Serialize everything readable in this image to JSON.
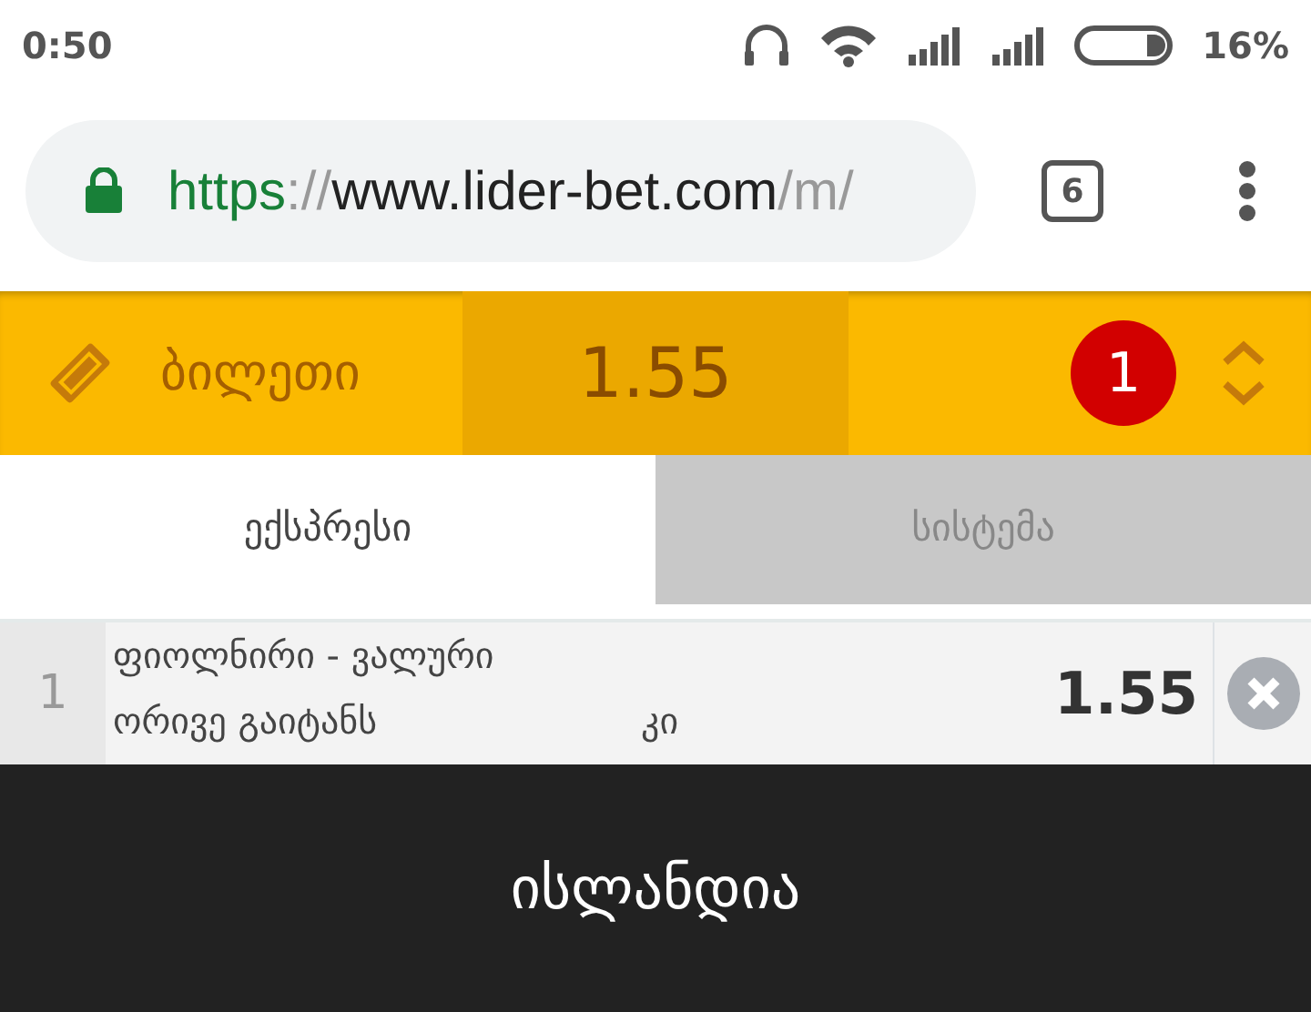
{
  "status_bar": {
    "time": "0:50",
    "battery": "16%"
  },
  "browser": {
    "url_scheme": "https",
    "url_separator": "://",
    "url_host": "www.lider-bet.com",
    "url_path": "/m/",
    "tab_count": "6"
  },
  "bet_slip": {
    "label": "ბილეთი",
    "total_odds": "1.55",
    "count": "1"
  },
  "tabs": [
    {
      "label": "ექსპრესი",
      "selected": true
    },
    {
      "label": "სისტემა",
      "selected": false
    }
  ],
  "bets": [
    {
      "number": "1",
      "match": "ფიოლნირი - ვალური",
      "market": "ორივე გაიტანს",
      "pick": "კი",
      "odds": "1.55"
    }
  ],
  "footer": {
    "title": "ისლანდია"
  }
}
